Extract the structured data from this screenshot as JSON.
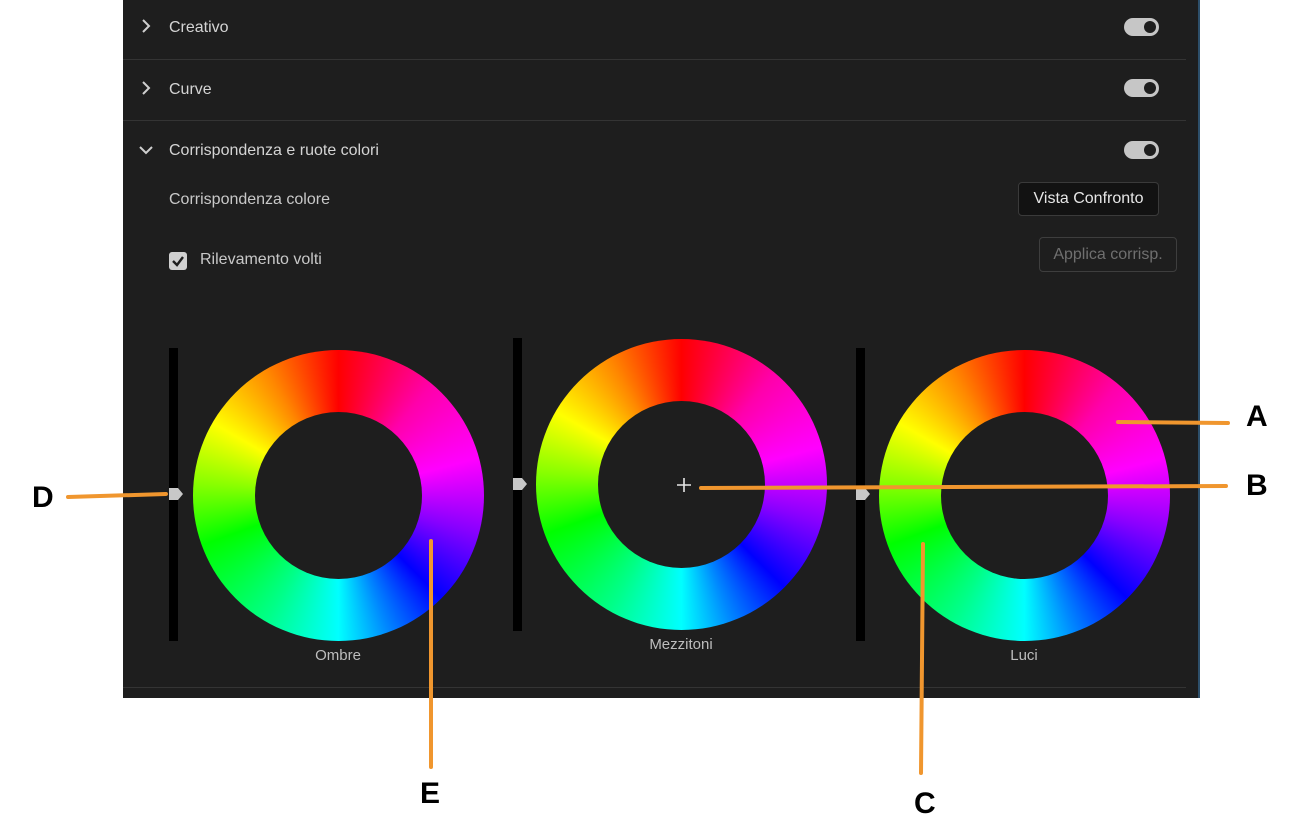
{
  "sections": [
    {
      "label": "Creativo",
      "expanded": false,
      "enabled": true
    },
    {
      "label": "Curve",
      "expanded": false,
      "enabled": true
    },
    {
      "label": "Corrispondenza e ruote colori",
      "expanded": true,
      "enabled": true
    }
  ],
  "color_match": {
    "label": "Corrispondenza colore",
    "compare_button": "Vista Confronto",
    "face_detection_label": "Rilevamento volti",
    "face_detection_checked": true,
    "apply_button": "Applica corrisp."
  },
  "wheels": [
    {
      "label": "Ombre"
    },
    {
      "label": "Mezzitoni"
    },
    {
      "label": "Luci"
    }
  ],
  "callouts": [
    "A",
    "B",
    "C",
    "D",
    "E"
  ],
  "colors": {
    "panel_bg": "#1e1e1e",
    "callout_line": "#f0962e",
    "toggle_on": "#c6c6c6"
  }
}
